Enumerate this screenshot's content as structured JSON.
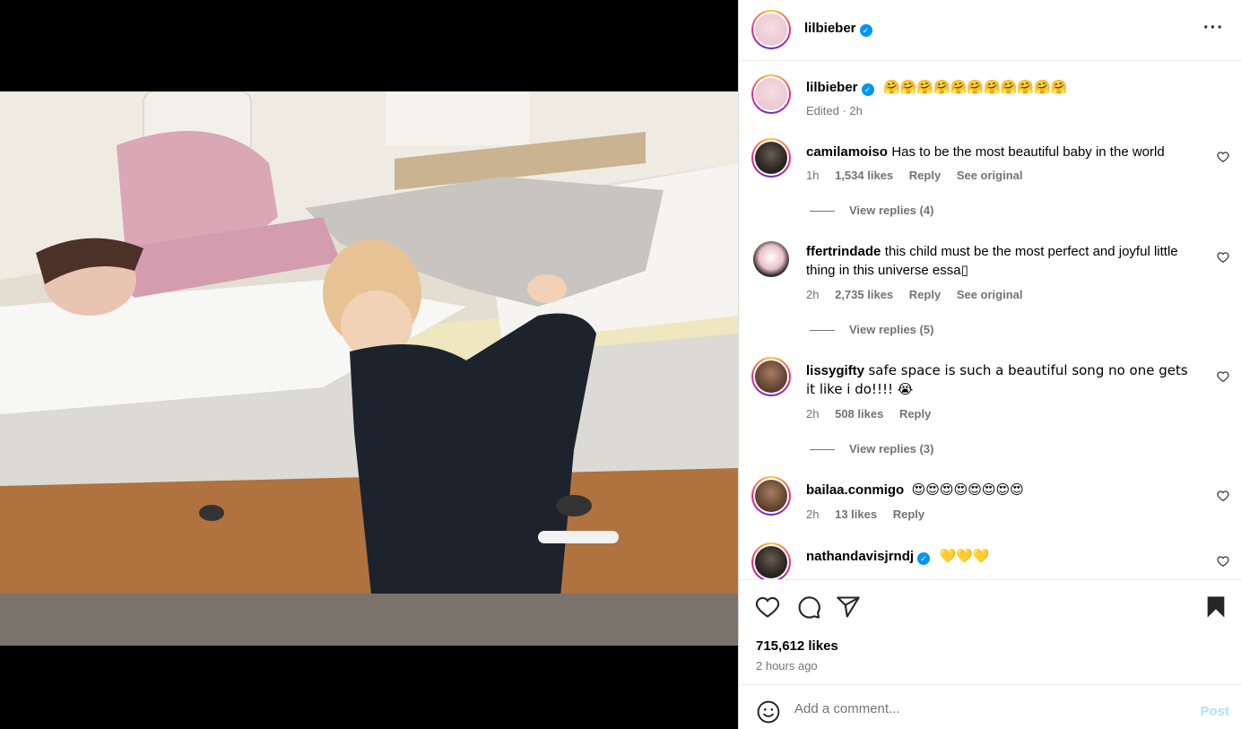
{
  "post": {
    "author": "lilbieber",
    "caption": "🤗🤗🤗🤗🤗🤗🤗🤗🤗🤗🤗",
    "caption_meta": "Edited · 2h",
    "likes": "715,612 likes",
    "time": "2 hours ago"
  },
  "comments": [
    {
      "user": "camilamoiso",
      "text": "Has to be the most beautiful baby in the world",
      "time": "1h",
      "likes": "1,534 likes",
      "reply": "Reply",
      "see_original": "See original",
      "view_replies": "View replies (4)"
    },
    {
      "user": "ffertrindade",
      "text": "this child must be the most perfect and joyful little thing in this universe essa",
      "time": "2h",
      "likes": "2,735 likes",
      "reply": "Reply",
      "see_original": "See original",
      "view_replies": "View replies (5)"
    },
    {
      "user": "lissygifty",
      "text": "safe space is such a beautiful song no one gets it like i do!!!! 😭",
      "time": "2h",
      "likes": "508 likes",
      "reply": "Reply",
      "view_replies": "View replies (3)"
    },
    {
      "user": "bailaa.conmigo",
      "text": "😍😍😍😍😍😍😍😍",
      "time": "2h",
      "likes": "13 likes",
      "reply": "Reply"
    },
    {
      "user": "nathandavisjrndj",
      "text": "💛💛💛"
    }
  ],
  "add_comment": {
    "placeholder": "Add a comment...",
    "post_label": "Post"
  },
  "icons": {
    "more": "more-options-icon",
    "like": "heart-icon",
    "comment": "comment-icon",
    "share": "send-icon",
    "save": "bookmark-icon",
    "emoji": "emoji-icon",
    "verified": "verified-badge-icon"
  },
  "colors": {
    "accent": "#0095f6",
    "post_disabled": "#b2dffc",
    "muted": "#737373"
  }
}
